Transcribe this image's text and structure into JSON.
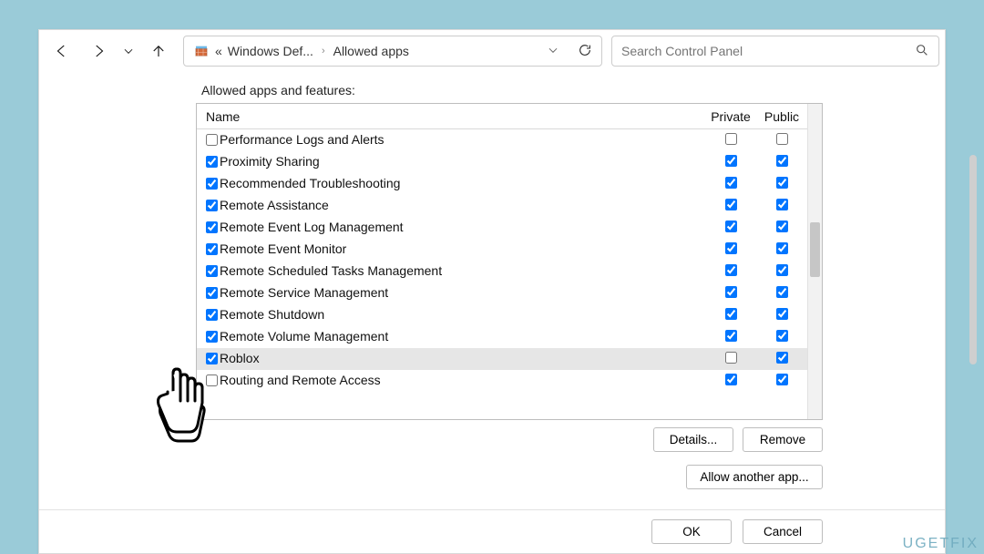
{
  "breadcrumb": {
    "prefix": "«",
    "seg1": "Windows Def...",
    "seg2": "Allowed apps"
  },
  "search": {
    "placeholder": "Search Control Panel"
  },
  "section_label": "Allowed apps and features:",
  "columns": {
    "name": "Name",
    "private": "Private",
    "public": "Public"
  },
  "rows": [
    {
      "name": "Performance Logs and Alerts",
      "checked": false,
      "private": false,
      "public": false,
      "selected": false
    },
    {
      "name": "Proximity Sharing",
      "checked": true,
      "private": true,
      "public": true,
      "selected": false
    },
    {
      "name": "Recommended Troubleshooting",
      "checked": true,
      "private": true,
      "public": true,
      "selected": false
    },
    {
      "name": "Remote Assistance",
      "checked": true,
      "private": true,
      "public": true,
      "selected": false
    },
    {
      "name": "Remote Event Log Management",
      "checked": true,
      "private": true,
      "public": true,
      "selected": false
    },
    {
      "name": "Remote Event Monitor",
      "checked": true,
      "private": true,
      "public": true,
      "selected": false
    },
    {
      "name": "Remote Scheduled Tasks Management",
      "checked": true,
      "private": true,
      "public": true,
      "selected": false
    },
    {
      "name": "Remote Service Management",
      "checked": true,
      "private": true,
      "public": true,
      "selected": false
    },
    {
      "name": "Remote Shutdown",
      "checked": true,
      "private": true,
      "public": true,
      "selected": false
    },
    {
      "name": "Remote Volume Management",
      "checked": true,
      "private": true,
      "public": true,
      "selected": false
    },
    {
      "name": "Roblox",
      "checked": true,
      "private": false,
      "public": true,
      "selected": true
    },
    {
      "name": "Routing and Remote Access",
      "checked": false,
      "private": true,
      "public": true,
      "selected": false
    }
  ],
  "buttons": {
    "details": "Details...",
    "remove": "Remove",
    "allow_another": "Allow another app...",
    "ok": "OK",
    "cancel": "Cancel"
  },
  "watermark": "UGETFIX"
}
